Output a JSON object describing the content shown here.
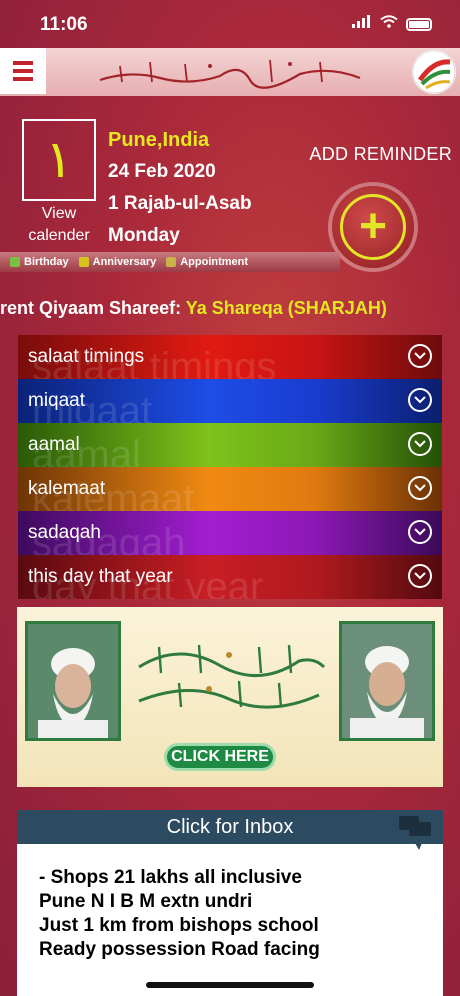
{
  "status_bar": {
    "time": "11:06"
  },
  "date_panel": {
    "arabic_day": "١",
    "view_calendar": "View calender",
    "city": "Pune,India",
    "gregorian_date": "24 Feb 2020",
    "hijri_date": "1 Rajab-ul-Asab",
    "weekday": "Monday"
  },
  "add_reminder_label": "ADD REMINDER",
  "legend": [
    {
      "label": "Birthday",
      "color": "#7ac143"
    },
    {
      "label": "Anniversary",
      "color": "#d6c21b"
    },
    {
      "label": "Appointment",
      "color": "#c9b24a"
    }
  ],
  "qiyaam": {
    "prefix": "rent Qiyaam Shareef: ",
    "place": "Ya Shareqa (SHARJAH)"
  },
  "menu_rows": [
    {
      "label": "salaat timings",
      "ghost": "salaat timings",
      "gradient": "linear-gradient(90deg,#7a0c0c,#e01a12 45%,#c81414 70%,#6d0b0b)"
    },
    {
      "label": "miqaat",
      "ghost": "miqaat",
      "gradient": "linear-gradient(90deg,#0b2278,#1e4de6 45%,#1a3ccf 70%,#0a1f6e)"
    },
    {
      "label": "aamal",
      "ghost": "aamal",
      "gradient": "linear-gradient(90deg,#2a5a08,#7fc21a 45%,#6aa818 70%,#244f07)"
    },
    {
      "label": "kalemaat",
      "ghost": "kalemaat",
      "gradient": "linear-gradient(90deg,#6e3406,#f08a12 45%,#e07a10 70%,#6a3005)"
    },
    {
      "label": "sadaqah",
      "ghost": "sadaqah",
      "gradient": "linear-gradient(90deg,#3e0a5e,#a21ed0 45%,#8c18b6 70%,#3a0a58)"
    },
    {
      "label": "this day that year",
      "ghost": "day that year",
      "gradient": "linear-gradient(90deg,#5a0a10,#c81e24 45%,#b01a1e 70%,#520a10)"
    }
  ],
  "banner": {
    "button_label": "CLICK HERE"
  },
  "inbox": {
    "title": "Click for Inbox",
    "lines": [
      "- Shops 21 lakhs all inclusive",
      "Pune N I B M extn undri",
      "Just 1 km from bishops school",
      "Ready possession Road facing"
    ]
  }
}
